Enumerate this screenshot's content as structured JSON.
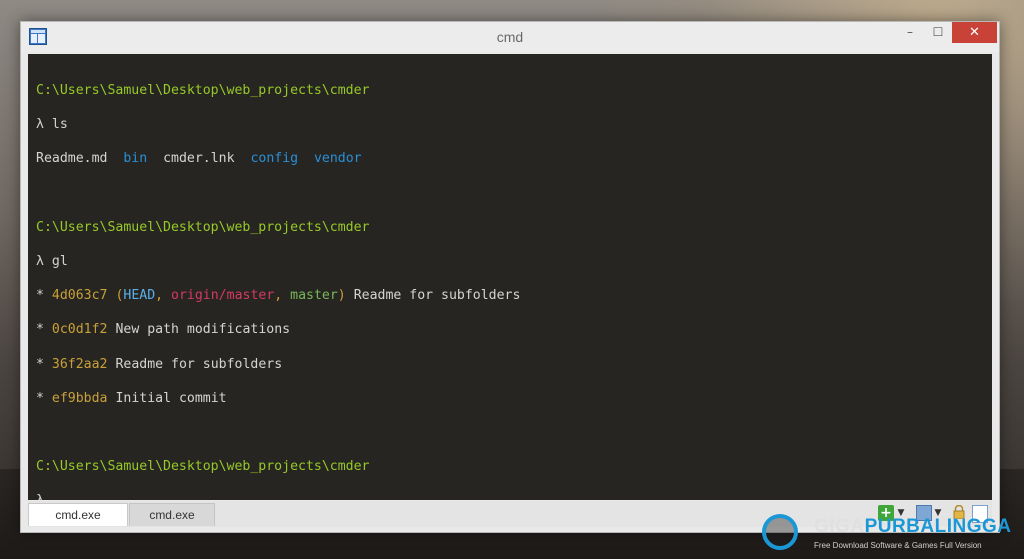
{
  "window": {
    "title": "cmd",
    "controls": {
      "minimize": "–",
      "maximize": "☐",
      "close": "✕"
    }
  },
  "terminal": {
    "block1": {
      "path": "C:\\Users\\Samuel\\Desktop\\web_projects\\cmder",
      "prompt": "λ",
      "command": "ls",
      "files": [
        "Readme.md",
        "bin",
        "cmder.lnk",
        "config",
        "vendor"
      ]
    },
    "block2": {
      "path": "C:\\Users\\Samuel\\Desktop\\web_projects\\cmder",
      "prompt": "λ",
      "command": "gl",
      "log": [
        {
          "bullet": "*",
          "hash": "4d063c7",
          "refs": {
            "head": "HEAD",
            "remote": "origin/master",
            "branch": "master"
          },
          "message": "Readme for subfolders"
        },
        {
          "bullet": "*",
          "hash": "0c0d1f2",
          "message": "New path modifications"
        },
        {
          "bullet": "*",
          "hash": "36f2aa2",
          "message": "Readme for subfolders"
        },
        {
          "bullet": "*",
          "hash": "ef9bbda",
          "message": "Initial commit"
        }
      ]
    },
    "block3": {
      "path": "C:\\Users\\Samuel\\Desktop\\web_projects\\cmder",
      "prompt": "λ"
    }
  },
  "tabs": [
    "cmd.exe",
    "cmd.exe"
  ],
  "toolbar": {
    "new_tab": "+",
    "dropdown": "▼"
  },
  "watermark": {
    "brand_first": "GIGA",
    "brand_second": "PURBALINGGA",
    "tagline": "Free Download Software & Games Full Version"
  },
  "colors": {
    "console_bg": "#262521",
    "path": "#97c928",
    "dir": "#2a8fd6",
    "hash": "#c9a13a",
    "remote": "#d43a63",
    "close_button": "#c94238"
  }
}
